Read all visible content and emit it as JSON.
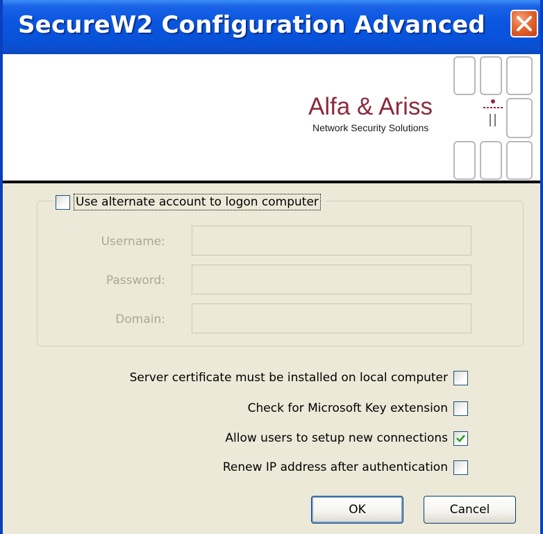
{
  "window": {
    "title": "SecureW2 Configuration Advanced",
    "close_icon": "close-icon",
    "titlebar_color": "#0a56e0"
  },
  "banner": {
    "logo_title": "Alfa & Ariss",
    "logo_subtitle": "Network Security Solutions",
    "logo_color": "#8a2b3f"
  },
  "alt_account": {
    "checkbox_label": "Use alternate account to logon computer",
    "checked": false,
    "fields": [
      {
        "label": "Username:",
        "value": ""
      },
      {
        "label": "Password:",
        "value": ""
      },
      {
        "label": "Domain:",
        "value": ""
      }
    ]
  },
  "options": [
    {
      "label": "Server certificate must be installed on local computer",
      "checked": false
    },
    {
      "label": "Check for Microsoft Key extension",
      "checked": false
    },
    {
      "label": "Allow users to setup new connections",
      "checked": true
    },
    {
      "label": "Renew IP address after authentication",
      "checked": false
    }
  ],
  "buttons": {
    "ok": "OK",
    "cancel": "Cancel"
  }
}
